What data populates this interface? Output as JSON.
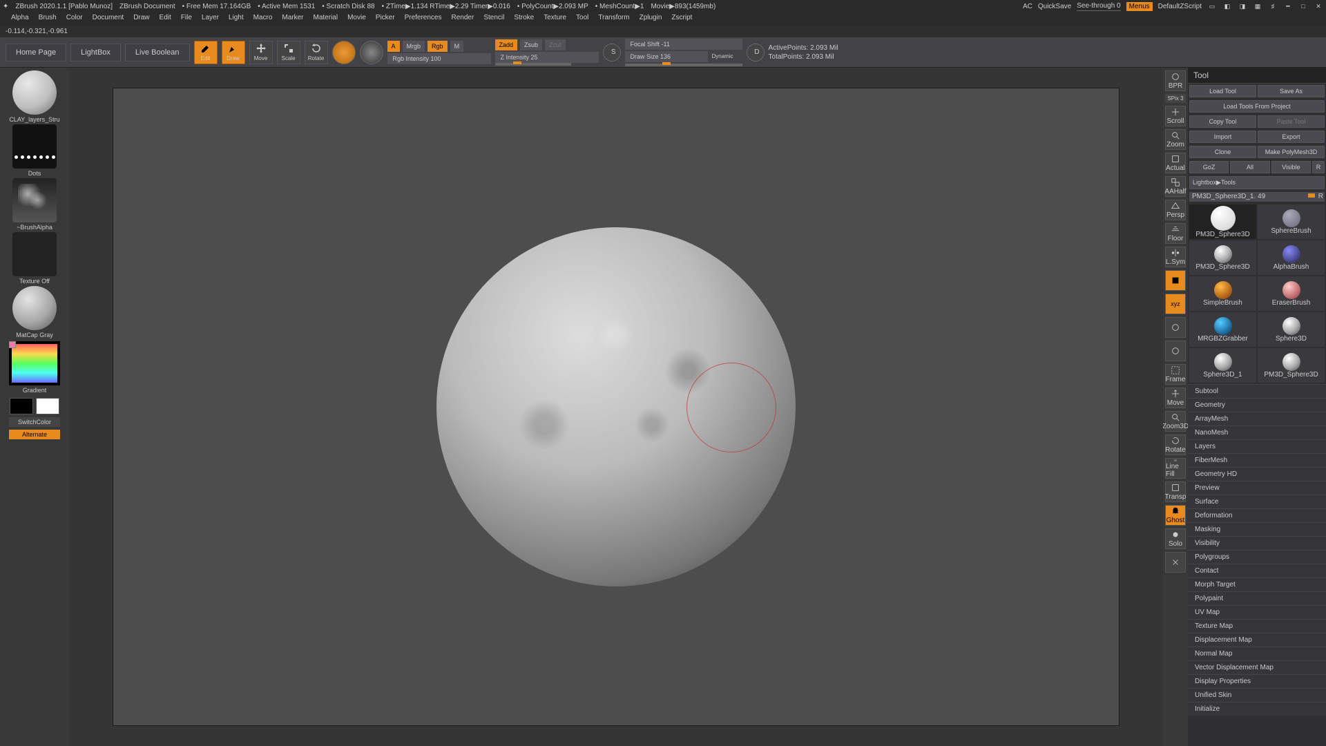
{
  "title": {
    "app": "ZBrush 2020.1.1 [Pablo Munoz]",
    "doc": "ZBrush Document",
    "mem": "• Free Mem 17.164GB",
    "active": "• Active Mem 1531",
    "scratch": "• Scratch Disk 88",
    "ztime": "• ZTime▶1.134 RTime▶2.29 Timer▶0.016",
    "poly": "• PolyCount▶2.093 MP",
    "mesh": "• MeshCount▶1",
    "movie": "Movie▶893(1459mb)",
    "ac": "AC",
    "quicksave": "QuickSave",
    "seethrough": "See-through  0",
    "menus": "Menus",
    "zscript": "DefaultZScript"
  },
  "menus": [
    "Alpha",
    "Brush",
    "Color",
    "Document",
    "Draw",
    "Edit",
    "File",
    "Layer",
    "Light",
    "Macro",
    "Marker",
    "Material",
    "Movie",
    "Picker",
    "Preferences",
    "Render",
    "Stencil",
    "Stroke",
    "Texture",
    "Tool",
    "Transform",
    "Zplugin",
    "Zscript"
  ],
  "coords": "-0.114,-0.321,-0.961",
  "tabs": {
    "home": "Home Page",
    "lightbox": "LightBox",
    "live": "Live Boolean"
  },
  "modes": {
    "edit": "Edit",
    "draw": "Draw",
    "move": "Move",
    "scale": "Scale",
    "rotate": "Rotate"
  },
  "paramsA": {
    "a": "A",
    "mrgb": "Mrgb",
    "rgb": "Rgb",
    "m": "M",
    "rgbint": "Rgb Intensity 100"
  },
  "paramsZ": {
    "zadd": "Zadd",
    "zsub": "Zsub",
    "zcut": "Zcut",
    "zint": "Z Intensity 25"
  },
  "focal": {
    "shift": "Focal Shift -11",
    "draw": "Draw Size 136",
    "dyn": "Dynamic"
  },
  "info": {
    "active": "ActivePoints: 2.093 Mil",
    "total": "TotalPoints: 2.093 Mil"
  },
  "left": {
    "brush": "CLAY_layers_Stru",
    "stroke": "Dots",
    "alpha": "~BrushAlpha",
    "texture": "Texture Off",
    "matcap": "MatCap Gray",
    "grad": "Gradient",
    "switch": "SwitchColor",
    "alt": "Alternate"
  },
  "ricons": [
    "BPR",
    "Scroll",
    "Zoom",
    "Actual",
    "AAHalf",
    "Persp",
    "Floor",
    "L.Sym",
    "",
    "xyz",
    "",
    "",
    "Frame",
    "Move",
    "Zoom3D",
    "Rotate",
    "Line Fill",
    "Transp",
    "Ghost",
    "Solo",
    ""
  ],
  "ricons_spix": "SPix 3",
  "tool": {
    "title": "Tool",
    "row1": [
      "Load Tool",
      "Save As"
    ],
    "row2": "Load Tools From Project",
    "row3": [
      "Copy Tool",
      "Paste Tool"
    ],
    "row4": [
      "Import",
      "Export"
    ],
    "row5": [
      "Clone",
      "Make PolyMesh3D"
    ],
    "row6": [
      "GoZ",
      "All",
      "Visible",
      "R"
    ],
    "lightbox": "Lightbox▶Tools",
    "current": "PM3D_Sphere3D_1. 49",
    "r": "R",
    "tools": [
      "PM3D_Sphere3D",
      "SphereBrush",
      "PM3D_Sphere3D",
      "AlphaBrush",
      "SimpleBrush",
      "EraserBrush",
      "MRGBZGrabber",
      "Sphere3D",
      "Sphere3D_1",
      "PM3D_Sphere3D"
    ],
    "accordion": [
      "Subtool",
      "Geometry",
      "ArrayMesh",
      "NanoMesh",
      "Layers",
      "FiberMesh",
      "Geometry HD",
      "Preview",
      "Surface",
      "Deformation",
      "Masking",
      "Visibility",
      "Polygroups",
      "Contact",
      "Morph Target",
      "Polypaint",
      "UV Map",
      "Texture Map",
      "Displacement Map",
      "Normal Map",
      "Vector Displacement Map",
      "Display Properties",
      "Unified Skin",
      "Initialize"
    ]
  }
}
